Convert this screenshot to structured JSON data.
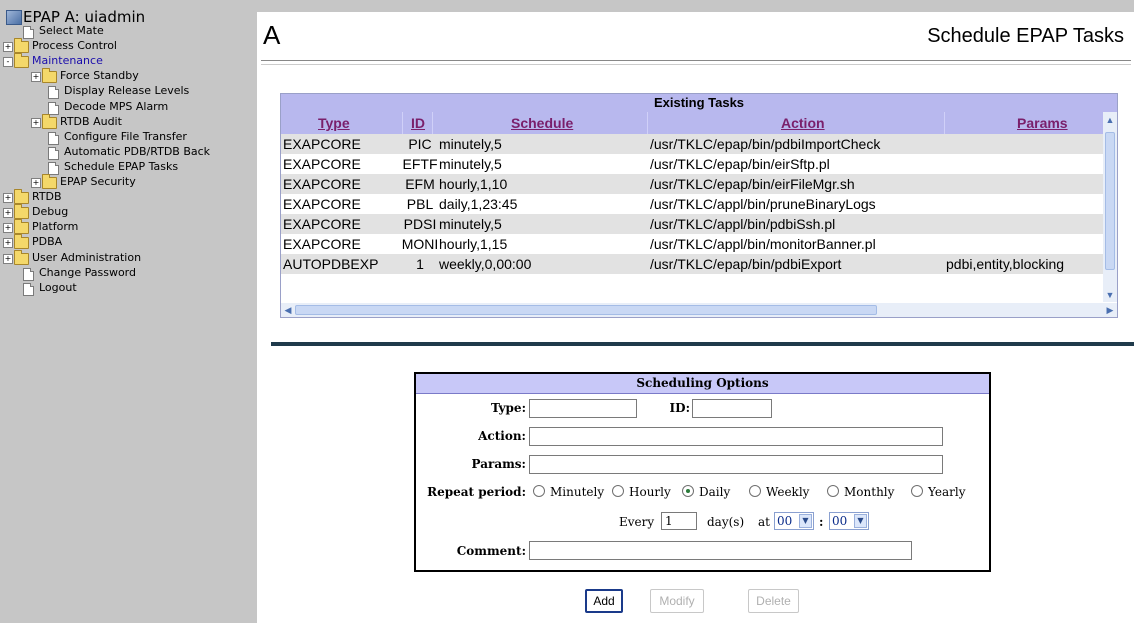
{
  "sidebar": {
    "title": "EPAP A: uiadmin",
    "items": [
      {
        "label": "Select Mate",
        "type": "page",
        "level": 1
      },
      {
        "label": "Process Control",
        "type": "folder",
        "level": 0,
        "expand": "+"
      },
      {
        "label": "Maintenance",
        "type": "folder-open",
        "level": 0,
        "expand": "-",
        "active": true
      },
      {
        "label": "Force Standby",
        "type": "folder",
        "level": 1,
        "expand": "+"
      },
      {
        "label": "Display Release Levels",
        "type": "page",
        "level": 2
      },
      {
        "label": "Decode MPS Alarm",
        "type": "page",
        "level": 2
      },
      {
        "label": "RTDB Audit",
        "type": "folder",
        "level": 1,
        "expand": "+"
      },
      {
        "label": "Configure File Transfer",
        "type": "page",
        "level": 2
      },
      {
        "label": "Automatic PDB/RTDB Back",
        "type": "page",
        "level": 2
      },
      {
        "label": "Schedule EPAP Tasks",
        "type": "page",
        "level": 2
      },
      {
        "label": "EPAP Security",
        "type": "folder",
        "level": 1,
        "expand": "+"
      },
      {
        "label": "RTDB",
        "type": "folder",
        "level": 0,
        "expand": "+"
      },
      {
        "label": "Debug",
        "type": "folder",
        "level": 0,
        "expand": "+"
      },
      {
        "label": "Platform",
        "type": "folder",
        "level": 0,
        "expand": "+"
      },
      {
        "label": "PDBA",
        "type": "folder",
        "level": 0,
        "expand": "+"
      },
      {
        "label": "User Administration",
        "type": "folder",
        "level": 0,
        "expand": "+"
      },
      {
        "label": "Change Password",
        "type": "page",
        "level": 1
      },
      {
        "label": "Logout",
        "type": "page",
        "level": 1
      }
    ]
  },
  "header": {
    "letter": "A",
    "title": "Schedule EPAP Tasks"
  },
  "tasks": {
    "title": "Existing Tasks",
    "columns": [
      "Type",
      "ID",
      "Schedule",
      "Action",
      "Params"
    ],
    "rows": [
      [
        "EXAPCORE",
        "PIC",
        "minutely,5",
        "/usr/TKLC/epap/bin/pdbiImportCheck",
        ""
      ],
      [
        "EXAPCORE",
        "EFTF",
        "minutely,5",
        "/usr/TKLC/epap/bin/eirSftp.pl",
        ""
      ],
      [
        "EXAPCORE",
        "EFM",
        "hourly,1,10",
        "/usr/TKLC/epap/bin/eirFileMgr.sh",
        ""
      ],
      [
        "EXAPCORE",
        "PBL",
        "daily,1,23:45",
        "/usr/TKLC/appl/bin/pruneBinaryLogs",
        ""
      ],
      [
        "EXAPCORE",
        "PDSI",
        "minutely,5",
        "/usr/TKLC/appl/bin/pdbiSsh.pl",
        ""
      ],
      [
        "EXAPCORE",
        "MONI",
        "hourly,1,15",
        "/usr/TKLC/appl/bin/monitorBanner.pl",
        ""
      ],
      [
        "AUTOPDBEXP",
        "1",
        "weekly,0,00:00",
        "/usr/TKLC/epap/bin/pdbiExport",
        "pdbi,entity,blocking"
      ]
    ]
  },
  "options": {
    "title": "Scheduling Options",
    "type_label": "Type:",
    "type_value": "",
    "id_label": "ID:",
    "id_value": "",
    "action_label": "Action:",
    "action_value": "",
    "params_label": "Params:",
    "params_value": "",
    "repeat_label": "Repeat period:",
    "periods": [
      "Minutely",
      "Hourly",
      "Daily",
      "Weekly",
      "Monthly",
      "Yearly"
    ],
    "selected_period": "Daily",
    "every_label": "Every",
    "every_value": "1",
    "days_label": "day(s)",
    "at_label": "at",
    "hour": "00",
    "colon": ":",
    "minute": "00",
    "comment_label": "Comment:",
    "comment_value": ""
  },
  "buttons": {
    "add": "Add",
    "modify": "Modify",
    "delete": "Delete"
  },
  "colors": {
    "sidebar_bg": "#c6c6c6",
    "table_header": "#b8b8ee",
    "link_header": "#7a1f6b",
    "divider": "#1f3a4b"
  }
}
